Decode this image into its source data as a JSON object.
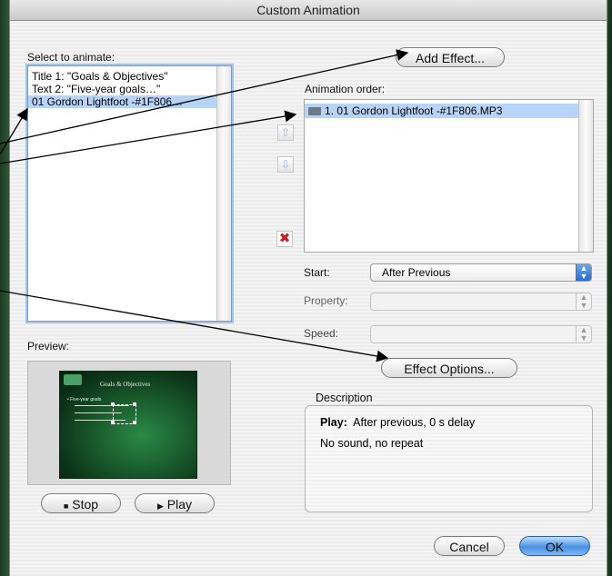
{
  "window": {
    "title": "Custom Animation"
  },
  "select_panel": {
    "label": "Select to animate:",
    "items": [
      "Title 1: \"Goals & Objectives\"",
      "Text 2: \"Five-year goals…\"",
      "01 Gordon Lightfoot -#1F806…"
    ]
  },
  "preview": {
    "label": "Preview:",
    "slide_title": "Goals & Objectives",
    "slide_bullet": "• Five-year goals",
    "stop_label": "Stop",
    "play_label": "Play",
    "stop_icon": "stop-square-icon",
    "play_icon": "play-triangle-icon"
  },
  "add_effect_label": "Add Effect...",
  "animation_order": {
    "label": "Animation order:",
    "items": [
      "1. 01 Gordon Lightfoot -#1F806.MP3"
    ]
  },
  "start": {
    "label": "Start:",
    "value": "After Previous"
  },
  "property": {
    "label": "Property:",
    "value": ""
  },
  "speed": {
    "label": "Speed:",
    "value": ""
  },
  "effect_options_label": "Effect Options...",
  "description": {
    "label": "Description",
    "line1_key": "Play:",
    "line1_value": "After previous, 0 s delay",
    "line2": "No sound, no repeat"
  },
  "buttons": {
    "cancel": "Cancel",
    "ok": "OK"
  },
  "colors": {
    "selection": "#b7d3f5",
    "default_button": "#4a90e2",
    "delete_red": "#d11a1a"
  }
}
